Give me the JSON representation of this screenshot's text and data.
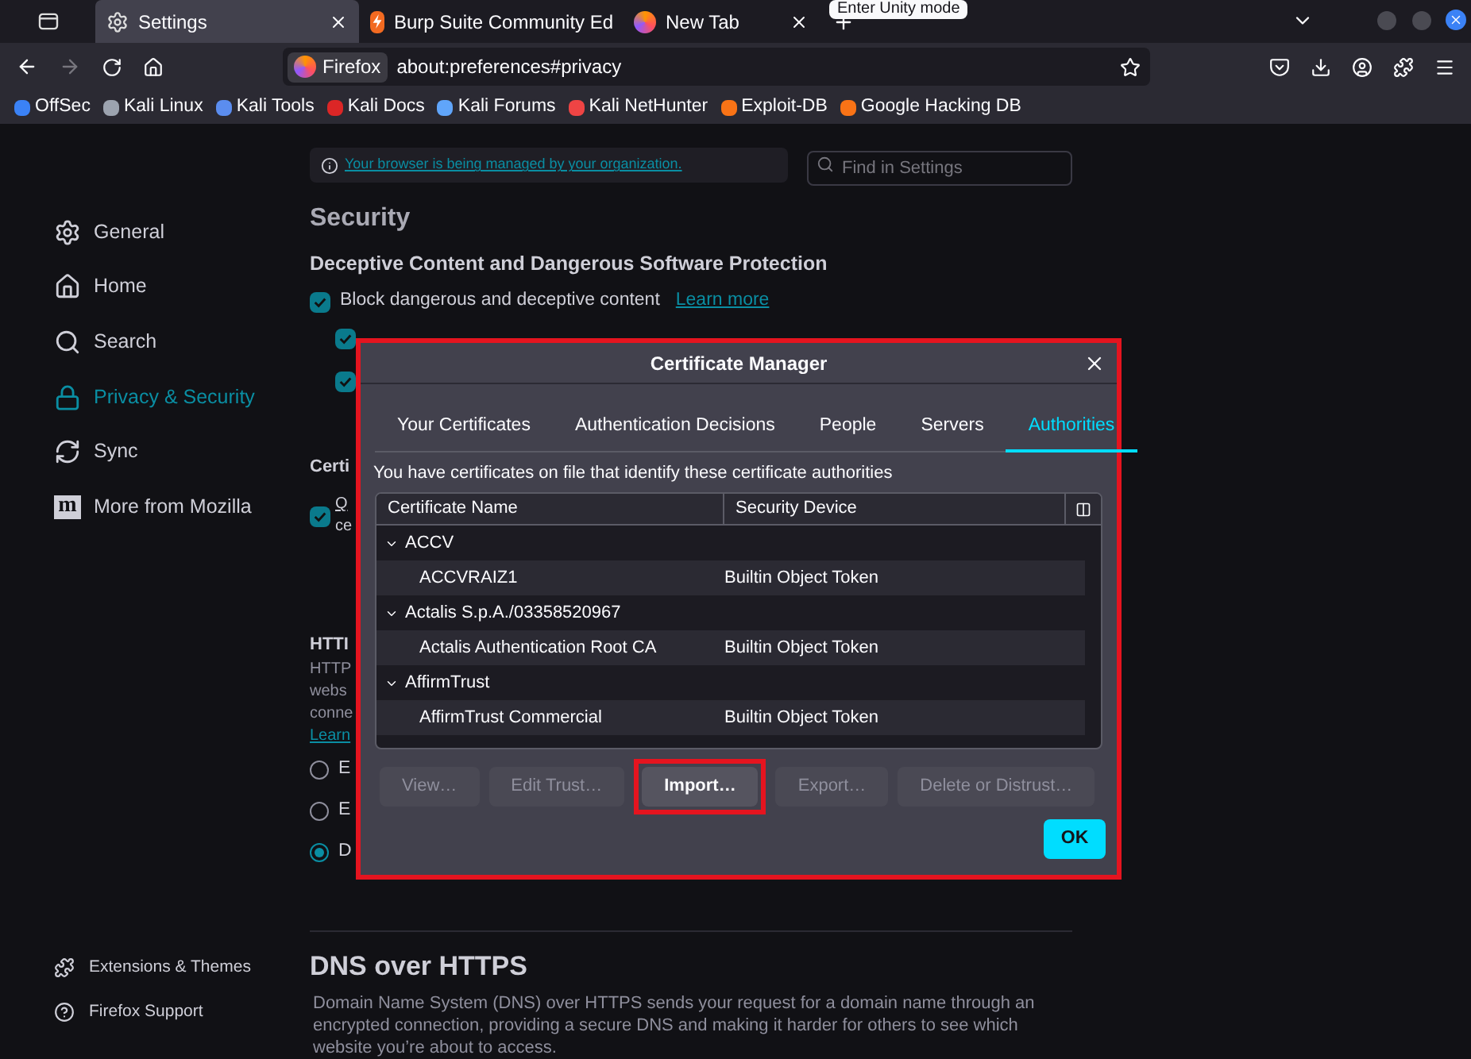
{
  "tabs": [
    {
      "title": "Settings",
      "selected": true
    },
    {
      "title": "Burp Suite Community Ed",
      "selected": false
    },
    {
      "title": "New Tab",
      "selected": false
    }
  ],
  "tooltip": "Enter Unity mode",
  "nav": {
    "forward_disabled": true,
    "identity": "Firefox",
    "url": "about:preferences#privacy"
  },
  "bookmarks": [
    {
      "label": "OffSec",
      "color": "#3b82f6"
    },
    {
      "label": "Kali Linux",
      "color": "#9ca3af"
    },
    {
      "label": "Kali Tools",
      "color": "#5b8def"
    },
    {
      "label": "Kali Docs",
      "color": "#dc2626"
    },
    {
      "label": "Kali Forums",
      "color": "#60a5fa"
    },
    {
      "label": "Kali NetHunter",
      "color": "#ef4444"
    },
    {
      "label": "Exploit-DB",
      "color": "#f97316"
    },
    {
      "label": "Google Hacking DB",
      "color": "#f97316"
    }
  ],
  "sidebar": {
    "items": [
      {
        "label": "General",
        "selected": false
      },
      {
        "label": "Home",
        "selected": false
      },
      {
        "label": "Search",
        "selected": false
      },
      {
        "label": "Privacy & Security",
        "selected": true
      },
      {
        "label": "Sync",
        "selected": false
      },
      {
        "label": "More from Mozilla",
        "logo_text": "m",
        "selected": false
      }
    ],
    "footer": [
      {
        "label": "Extensions & Themes"
      },
      {
        "label": "Firefox Support"
      }
    ]
  },
  "settings": {
    "managed_notice": "Your browser is being managed by your organization.",
    "search": {
      "placeholder": "Find in Settings"
    },
    "security_heading": "Security",
    "deceptive_heading": "Deceptive Content and Dangerous Software Protection",
    "block_option": {
      "label": "Block dangerous and deceptive content",
      "checked": true,
      "link": "Learn more"
    },
    "sub_options": [
      {
        "checked": true
      },
      {
        "checked": true
      }
    ],
    "certificates_heading": "Certi",
    "certificate_option": {
      "checked": true,
      "lines": [
        "Q",
        "ce"
      ]
    },
    "https_heading": "HTTI",
    "https_lines": [
      "HTTP",
      "webs",
      "conne"
    ],
    "https_link": "Learn",
    "https_radios": [
      {
        "label": "E",
        "selected": false
      },
      {
        "label": "E",
        "selected": false
      },
      {
        "label": "D",
        "selected": true
      }
    ],
    "dns_heading": "DNS over HTTPS",
    "dns_text": "Domain Name System (DNS) over HTTPS sends your request for a domain name through an encrypted connection, providing a secure DNS and making it harder for others to see which website you’re about to access."
  },
  "dialog": {
    "title": "Certificate Manager",
    "tabs": [
      {
        "label": "Your Certificates",
        "selected": false
      },
      {
        "label": "Authentication Decisions",
        "selected": false
      },
      {
        "label": "People",
        "selected": false
      },
      {
        "label": "Servers",
        "selected": false
      },
      {
        "label": "Authorities",
        "selected": true
      }
    ],
    "description": "You have certificates on file that identify these certificate authorities",
    "columns": [
      "Certificate Name",
      "Security Device"
    ],
    "groups": [
      {
        "name": "ACCV",
        "expanded": true,
        "children": [
          {
            "name": "ACCVRAIZ1",
            "device": "Builtin Object Token"
          }
        ]
      },
      {
        "name": "Actalis S.p.A./03358520967",
        "expanded": true,
        "children": [
          {
            "name": "Actalis Authentication Root CA",
            "device": "Builtin Object Token"
          }
        ]
      },
      {
        "name": "AffirmTrust",
        "expanded": true,
        "children": [
          {
            "name": "AffirmTrust Commercial",
            "device": "Builtin Object Token"
          }
        ]
      }
    ],
    "buttons": [
      {
        "label": "View…",
        "disabled": true,
        "highlighted": false
      },
      {
        "label": "Edit Trust…",
        "disabled": true,
        "highlighted": false
      },
      {
        "label": "Import…",
        "disabled": false,
        "highlighted": true
      },
      {
        "label": "Export…",
        "disabled": true,
        "highlighted": false
      },
      {
        "label": "Delete or Distrust…",
        "disabled": true,
        "highlighted": false
      }
    ],
    "ok": "OK"
  }
}
